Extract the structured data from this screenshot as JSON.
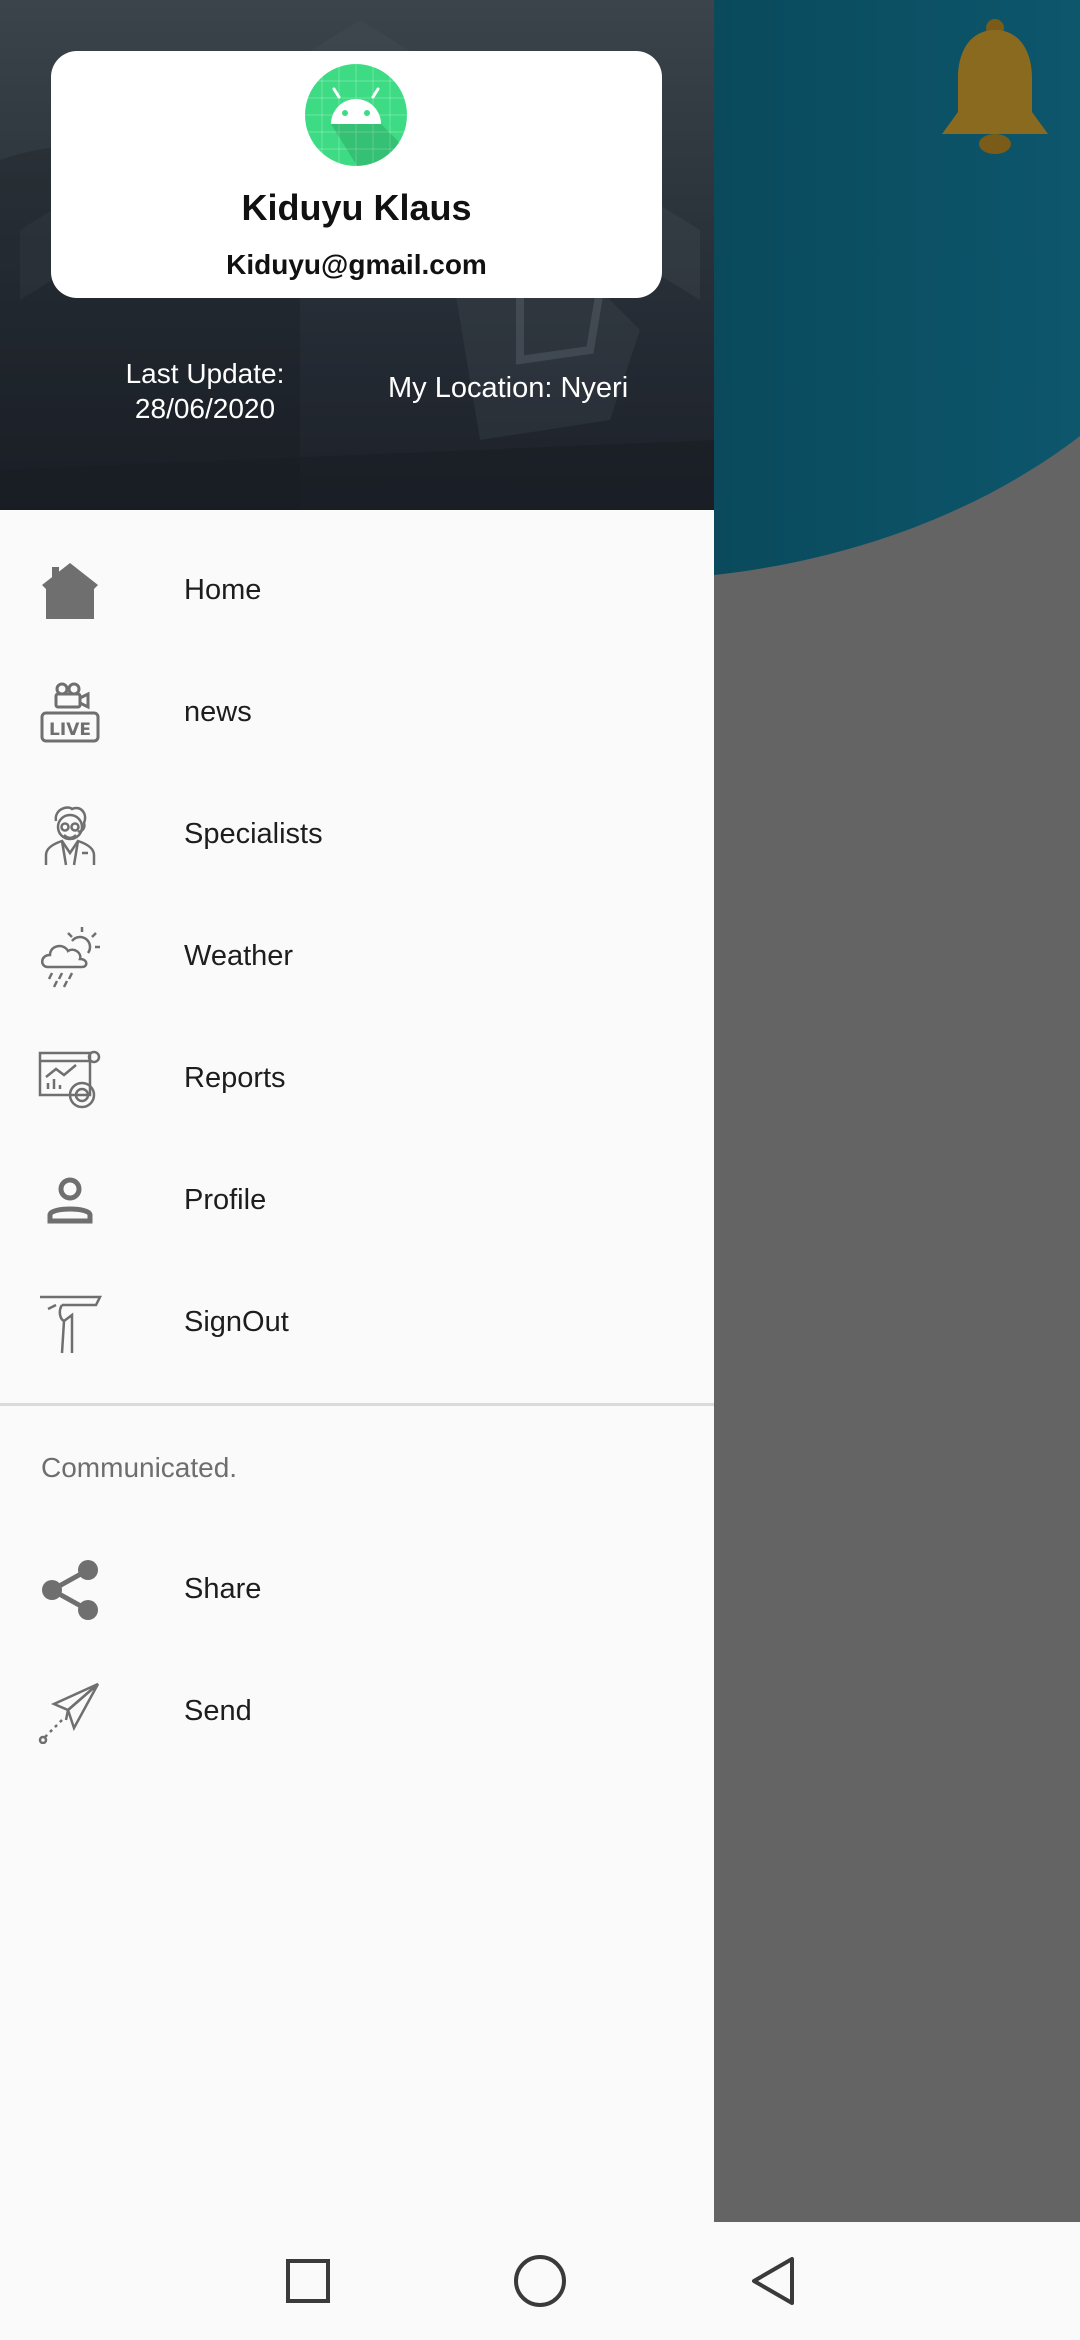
{
  "user": {
    "name": "Kiduyu Klaus",
    "email": "Kiduyu@gmail.com"
  },
  "header": {
    "last_update_label": "Last Update:",
    "last_update_date": "28/06/2020",
    "location": "My Location: Nyeri"
  },
  "menu": {
    "items": [
      {
        "label": "Home",
        "icon": "home-icon"
      },
      {
        "label": "news",
        "icon": "live-camera-icon"
      },
      {
        "label": "Specialists",
        "icon": "doctor-icon"
      },
      {
        "label": "Weather",
        "icon": "weather-cloud-icon"
      },
      {
        "label": "Reports",
        "icon": "report-chart-icon"
      },
      {
        "label": "Profile",
        "icon": "person-icon"
      },
      {
        "label": "SignOut",
        "icon": "signout-hand-icon"
      }
    ]
  },
  "communicate": {
    "title": "Communicated.",
    "items": [
      {
        "label": "Share",
        "icon": "share-icon"
      },
      {
        "label": "Send",
        "icon": "paper-plane-icon"
      }
    ]
  },
  "navbar": {
    "buttons": [
      "recents-icon",
      "home-circle-icon",
      "back-triangle-icon"
    ]
  },
  "colors": {
    "teal": "#0b4f63",
    "scrim": "#646464",
    "avatar_green": "#3ddc84",
    "bell": "#8a6a1e",
    "icon_gray": "#6f6f6f"
  }
}
